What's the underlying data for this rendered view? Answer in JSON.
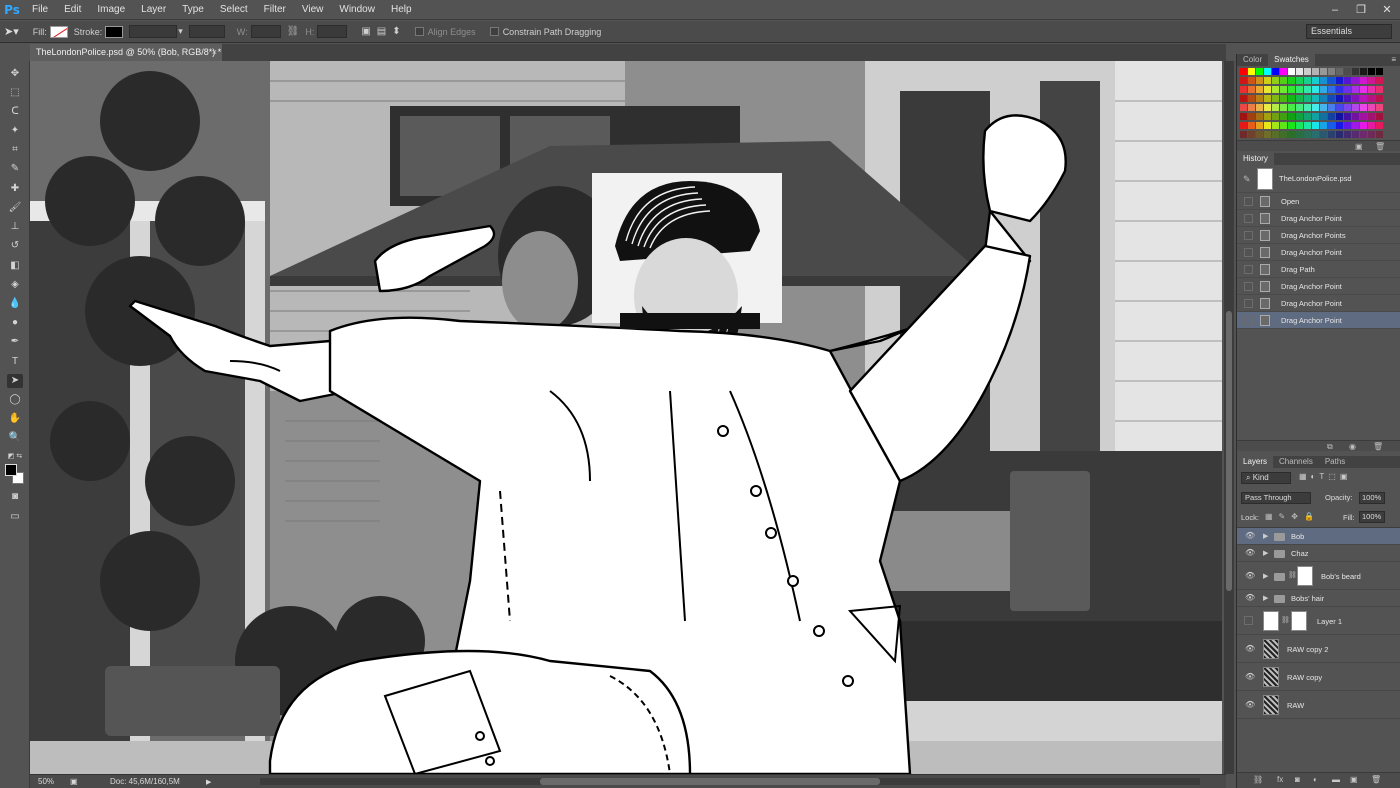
{
  "app": {
    "logo": "Ps"
  },
  "menu": [
    "File",
    "Edit",
    "Image",
    "Layer",
    "Type",
    "Select",
    "Filter",
    "View",
    "Window",
    "Help"
  ],
  "options": {
    "fill_label": "Fill:",
    "stroke_label": "Stroke:",
    "w_label": "W:",
    "h_label": "H:",
    "align_edges": "Align Edges",
    "constrain": "Constrain Path Dragging",
    "workspace": "Essentials"
  },
  "document": {
    "tab_title": "TheLondonPolice.psd @ 50% (Bob, RGB/8*) *",
    "close": "×"
  },
  "status": {
    "zoom": "50%",
    "doc": "Doc: 45,6M/160,5M"
  },
  "panels": {
    "color_tab": "Color",
    "swatches_tab": "Swatches",
    "history_title": "History",
    "history_snapshot": "TheLondonPolice.psd",
    "history_items": [
      "Open",
      "Drag Anchor Point",
      "Drag Anchor Points",
      "Drag Anchor Point",
      "Drag Path",
      "Drag Anchor Point",
      "Drag Anchor Point",
      "Drag Anchor Point"
    ],
    "layers_tab": "Layers",
    "channels_tab": "Channels",
    "paths_tab": "Paths",
    "kind": "Kind",
    "blend_mode": "Pass Through",
    "opacity_label": "Opacity:",
    "opacity": "100%",
    "lock_label": "Lock:",
    "fill_label": "Fill:",
    "fill": "100%",
    "layers": [
      {
        "name": "Bob",
        "type": "group",
        "visible": true,
        "selected": true
      },
      {
        "name": "Chaz",
        "type": "group",
        "visible": true,
        "selected": false
      },
      {
        "name": "Bob's beard",
        "type": "group-mask",
        "visible": true,
        "selected": false
      },
      {
        "name": "Bobs' hair",
        "type": "group",
        "visible": true,
        "selected": false
      },
      {
        "name": "Layer 1",
        "type": "layer-mask",
        "visible": false,
        "selected": false
      },
      {
        "name": "RAW copy 2",
        "type": "raster",
        "visible": true,
        "selected": false
      },
      {
        "name": "RAW copy",
        "type": "raster",
        "visible": true,
        "selected": false
      },
      {
        "name": "RAW",
        "type": "raster",
        "visible": true,
        "selected": false
      }
    ]
  },
  "colors": {
    "accent": "#5e6b80",
    "panel": "#535353",
    "dark": "#424242",
    "ps_blue": "#31a8ff"
  }
}
